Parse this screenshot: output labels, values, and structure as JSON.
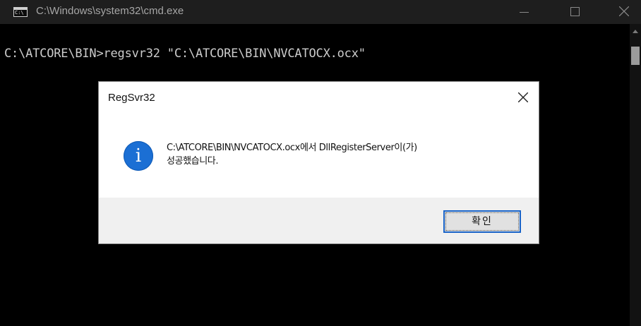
{
  "window": {
    "title": "C:\\Windows\\system32\\cmd.exe",
    "icon_text": "C:\\",
    "buttons": {
      "minimize": "minimize-icon",
      "maximize": "maximize-icon",
      "close": "close-icon"
    }
  },
  "console": {
    "line1": "C:\\ATCORE\\BIN>regsvr32 \"C:\\ATCORE\\BIN\\NVCATOCX.ocx\""
  },
  "dialog": {
    "title": "RegSvr32",
    "icon": "info-icon",
    "icon_letter": "i",
    "message_line1": "C:\\ATCORE\\BIN\\NVCATOCX.ocx에서 DllRegisterServer이(가)",
    "message_line2": "성공했습니다.",
    "ok_label": "확인"
  },
  "colors": {
    "console_bg": "#000000",
    "titlebar_bg": "#1e1e1e",
    "accent": "#1a64c8",
    "info_blue": "#1b6fd4"
  }
}
